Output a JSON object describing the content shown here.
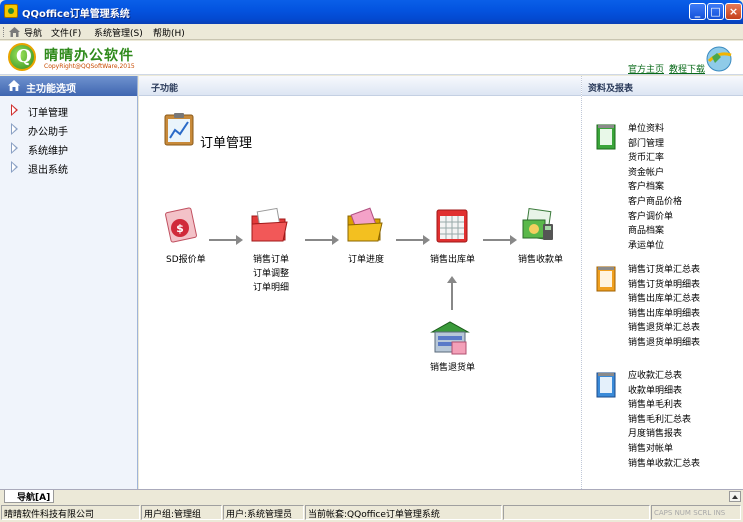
{
  "window": {
    "title": "QQoffice订单管理系统"
  },
  "menu": [
    {
      "label": "导航"
    },
    {
      "label": "文件(F)"
    },
    {
      "label": "系统管理(S)"
    },
    {
      "label": "帮助(H)"
    }
  ],
  "header": {
    "logo_title": "晴晴办公软件",
    "logo_subtitle": "CopyRight@QQSoftWare,2015",
    "links": [
      "官方主页",
      "教程下载"
    ]
  },
  "left_panel": {
    "title": "主功能选项",
    "items": [
      {
        "label": "订单管理",
        "active": true
      },
      {
        "label": "办公助手",
        "active": false
      },
      {
        "label": "系统维护",
        "active": false
      },
      {
        "label": "退出系统",
        "active": false
      }
    ]
  },
  "center": {
    "section_title": "子功能",
    "module_title": "订单管理",
    "flow": [
      {
        "icon": "quote-icon",
        "labels": [
          "SD报价单"
        ]
      },
      {
        "icon": "sales-order-folder-icon",
        "labels": [
          "销售订单",
          "订单调整",
          "订单明细"
        ]
      },
      {
        "icon": "order-progress-folder-icon",
        "labels": [
          "订单进度"
        ]
      },
      {
        "icon": "calendar-sheet-icon",
        "labels": [
          "销售出库单"
        ]
      },
      {
        "icon": "receipt-money-icon",
        "labels": [
          "销售收款单"
        ]
      },
      {
        "icon": "return-warehouse-icon",
        "labels": [
          "销售退货单"
        ]
      }
    ]
  },
  "reports": {
    "section_title": "资料及报表",
    "groups": [
      {
        "color": "#3aa53a",
        "items": [
          "单位资料",
          "部门管理",
          "货币汇率",
          "资金帐户",
          "客户档案",
          "客户商品价格",
          "客户调价单",
          "商品档案",
          "承运单位"
        ]
      },
      {
        "color": "#f0a020",
        "items": [
          "销售订货单汇总表",
          "销售订货单明细表",
          "销售出库单汇总表",
          "销售出库单明细表",
          "销售退货单汇总表",
          "销售退货单明细表"
        ]
      },
      {
        "color": "#3a8ad8",
        "items": [
          "应收款汇总表",
          "收款单明细表",
          "销售单毛利表",
          "销售毛利汇总表",
          "月度销售报表",
          "销售对帐单",
          "销售单收款汇总表"
        ]
      }
    ]
  },
  "bottom_tab": {
    "label": "导航[A]"
  },
  "status": {
    "company": "晴晴软件科技有限公司",
    "user_group": "用户组:管理组",
    "user": "用户:系统管理员",
    "account": "当前帐套:QQoffice订单管理系统",
    "indicators": "CAPS NUM SCRL INS"
  }
}
